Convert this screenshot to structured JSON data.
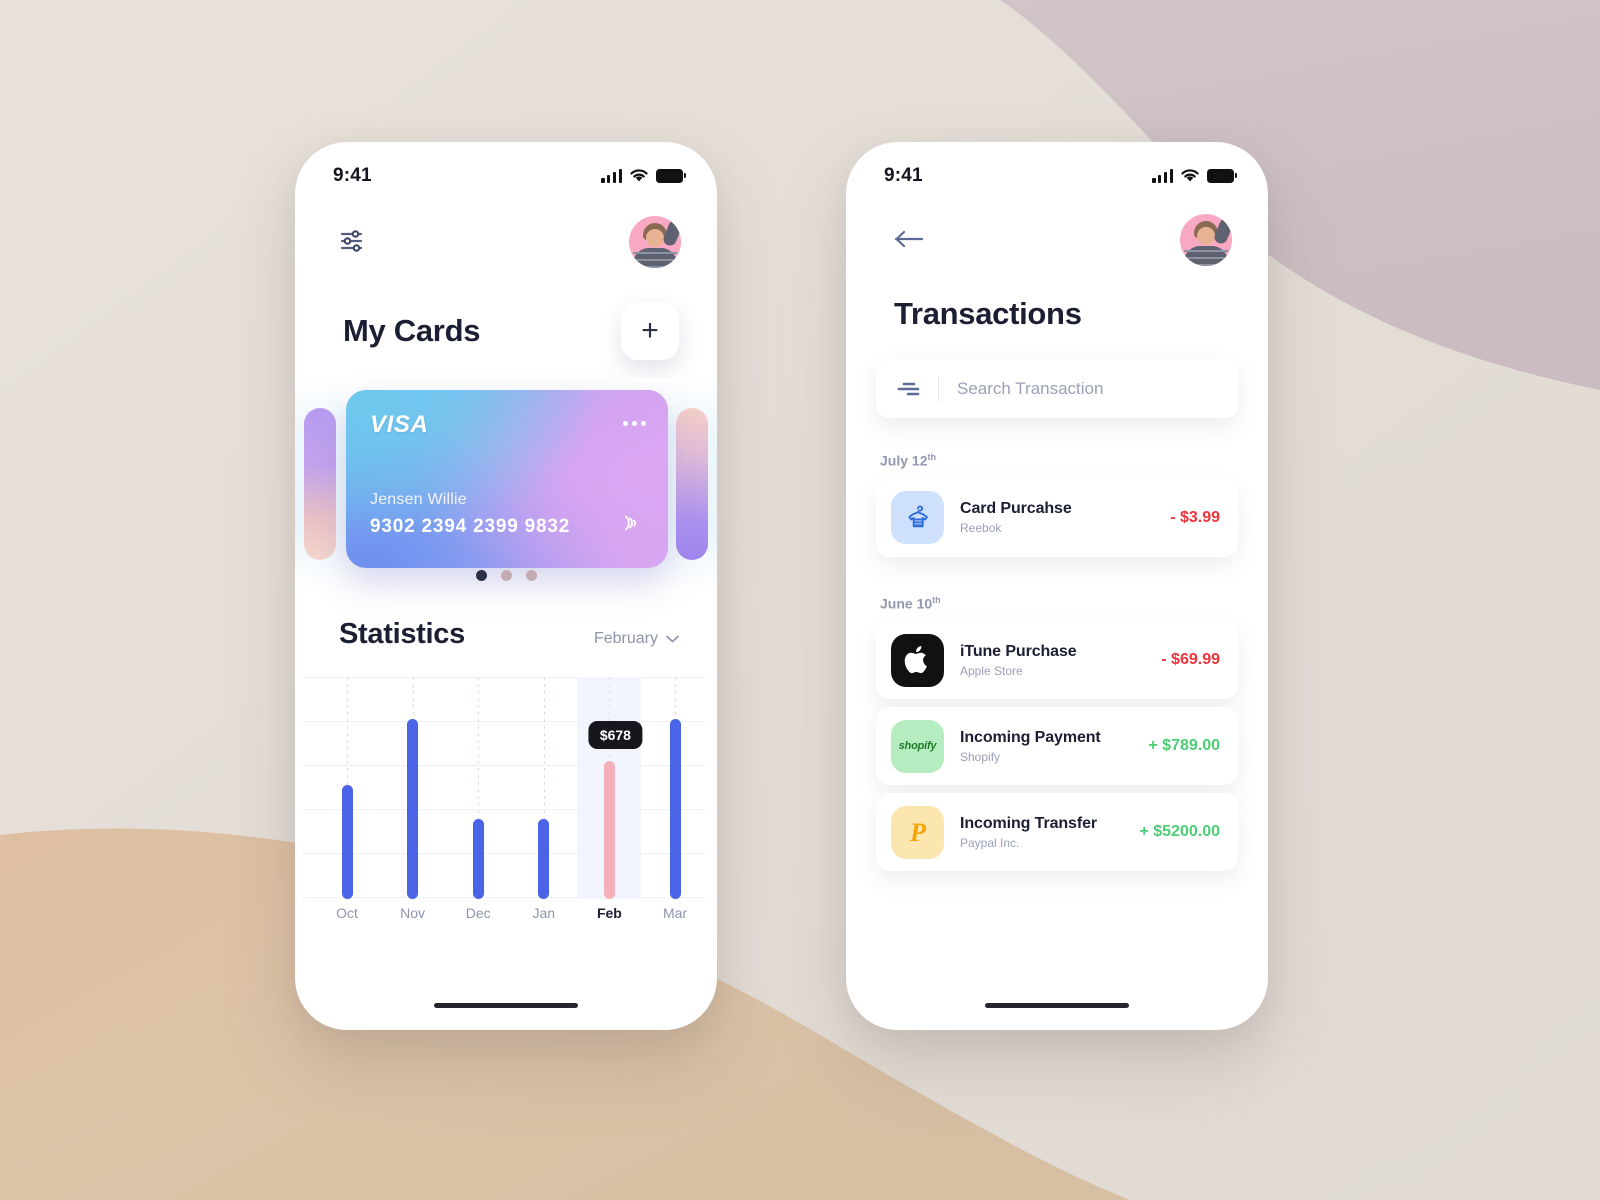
{
  "background": {
    "base_color": "#e4ded7",
    "mauve_color": "#cfc1c4",
    "tan_color": "#dcc3a8"
  },
  "phone_left": {
    "status": {
      "time": "9:41",
      "signal_icon": "cellular-signal-icon",
      "wifi_icon": "wifi-icon",
      "battery_icon": "battery-icon"
    },
    "header": {
      "settings_icon": "sliders-settings-icon",
      "avatar": "user-avatar"
    },
    "page_title": "My Cards",
    "add_card_label": "+",
    "card": {
      "brand": "VISA",
      "menu_icon": "more-options-icon",
      "holder": "Jensen Willie",
      "number": "9302  2394  2399 9832",
      "contactless_icon": "contactless-payment-icon"
    },
    "pager": {
      "total": 3,
      "active_index": 0
    },
    "statistics": {
      "title": "Statistics",
      "month": "February",
      "chevron_icon": "chevron-down-icon"
    },
    "home_indicator": "home-indicator"
  },
  "phone_right": {
    "status": {
      "time": "9:41",
      "signal_icon": "cellular-signal-icon",
      "wifi_icon": "wifi-icon",
      "battery_icon": "battery-icon"
    },
    "header": {
      "back_icon": "arrow-left-icon",
      "avatar": "user-avatar"
    },
    "page_title": "Transactions",
    "search": {
      "filter_icon": "filter-lines-icon",
      "placeholder": "Search Transaction",
      "value": ""
    },
    "groups": [
      {
        "date": "July 12",
        "date_suffix": "th",
        "items": [
          {
            "icon": "tshirt-hanger-icon",
            "icon_bg": "#cfe0fd",
            "title": "Card Purcahse",
            "subtitle": "Reebok",
            "amount": "- $3.99",
            "sign": "neg"
          }
        ]
      },
      {
        "date": "June 10",
        "date_suffix": "th",
        "items": [
          {
            "icon": "apple-logo-icon",
            "icon_bg": "#111111",
            "title": "iTune Purchase",
            "subtitle": "Apple Store",
            "amount": "- $69.99",
            "sign": "neg"
          },
          {
            "icon": "shopify-logo-icon",
            "icon_bg": "#b6edc0",
            "title": "Incoming Payment",
            "subtitle": "Shopify",
            "amount": "+ $789.00",
            "sign": "pos"
          },
          {
            "icon": "paypal-logo-icon",
            "icon_bg": "#fbe6af",
            "title": "Incoming Transfer",
            "subtitle": "Paypal Inc.",
            "amount": "+ $5200.00",
            "sign": "pos"
          }
        ]
      }
    ],
    "home_indicator": "home-indicator"
  },
  "chart_data": {
    "type": "bar",
    "title": "Statistics",
    "categories": [
      "Oct",
      "Nov",
      "Dec",
      "Jan",
      "Feb",
      "Mar"
    ],
    "values": [
      560,
      880,
      390,
      390,
      678,
      880
    ],
    "highlight_category": "Feb",
    "highlight_value": 678,
    "tooltip_label": "$678",
    "bar_color": "#4a63e7",
    "highlight_bar_color": "#f4b0b8",
    "xlabel": "",
    "ylabel": "",
    "ylim": [
      0,
      1000
    ],
    "grid": true,
    "legend": "none"
  }
}
